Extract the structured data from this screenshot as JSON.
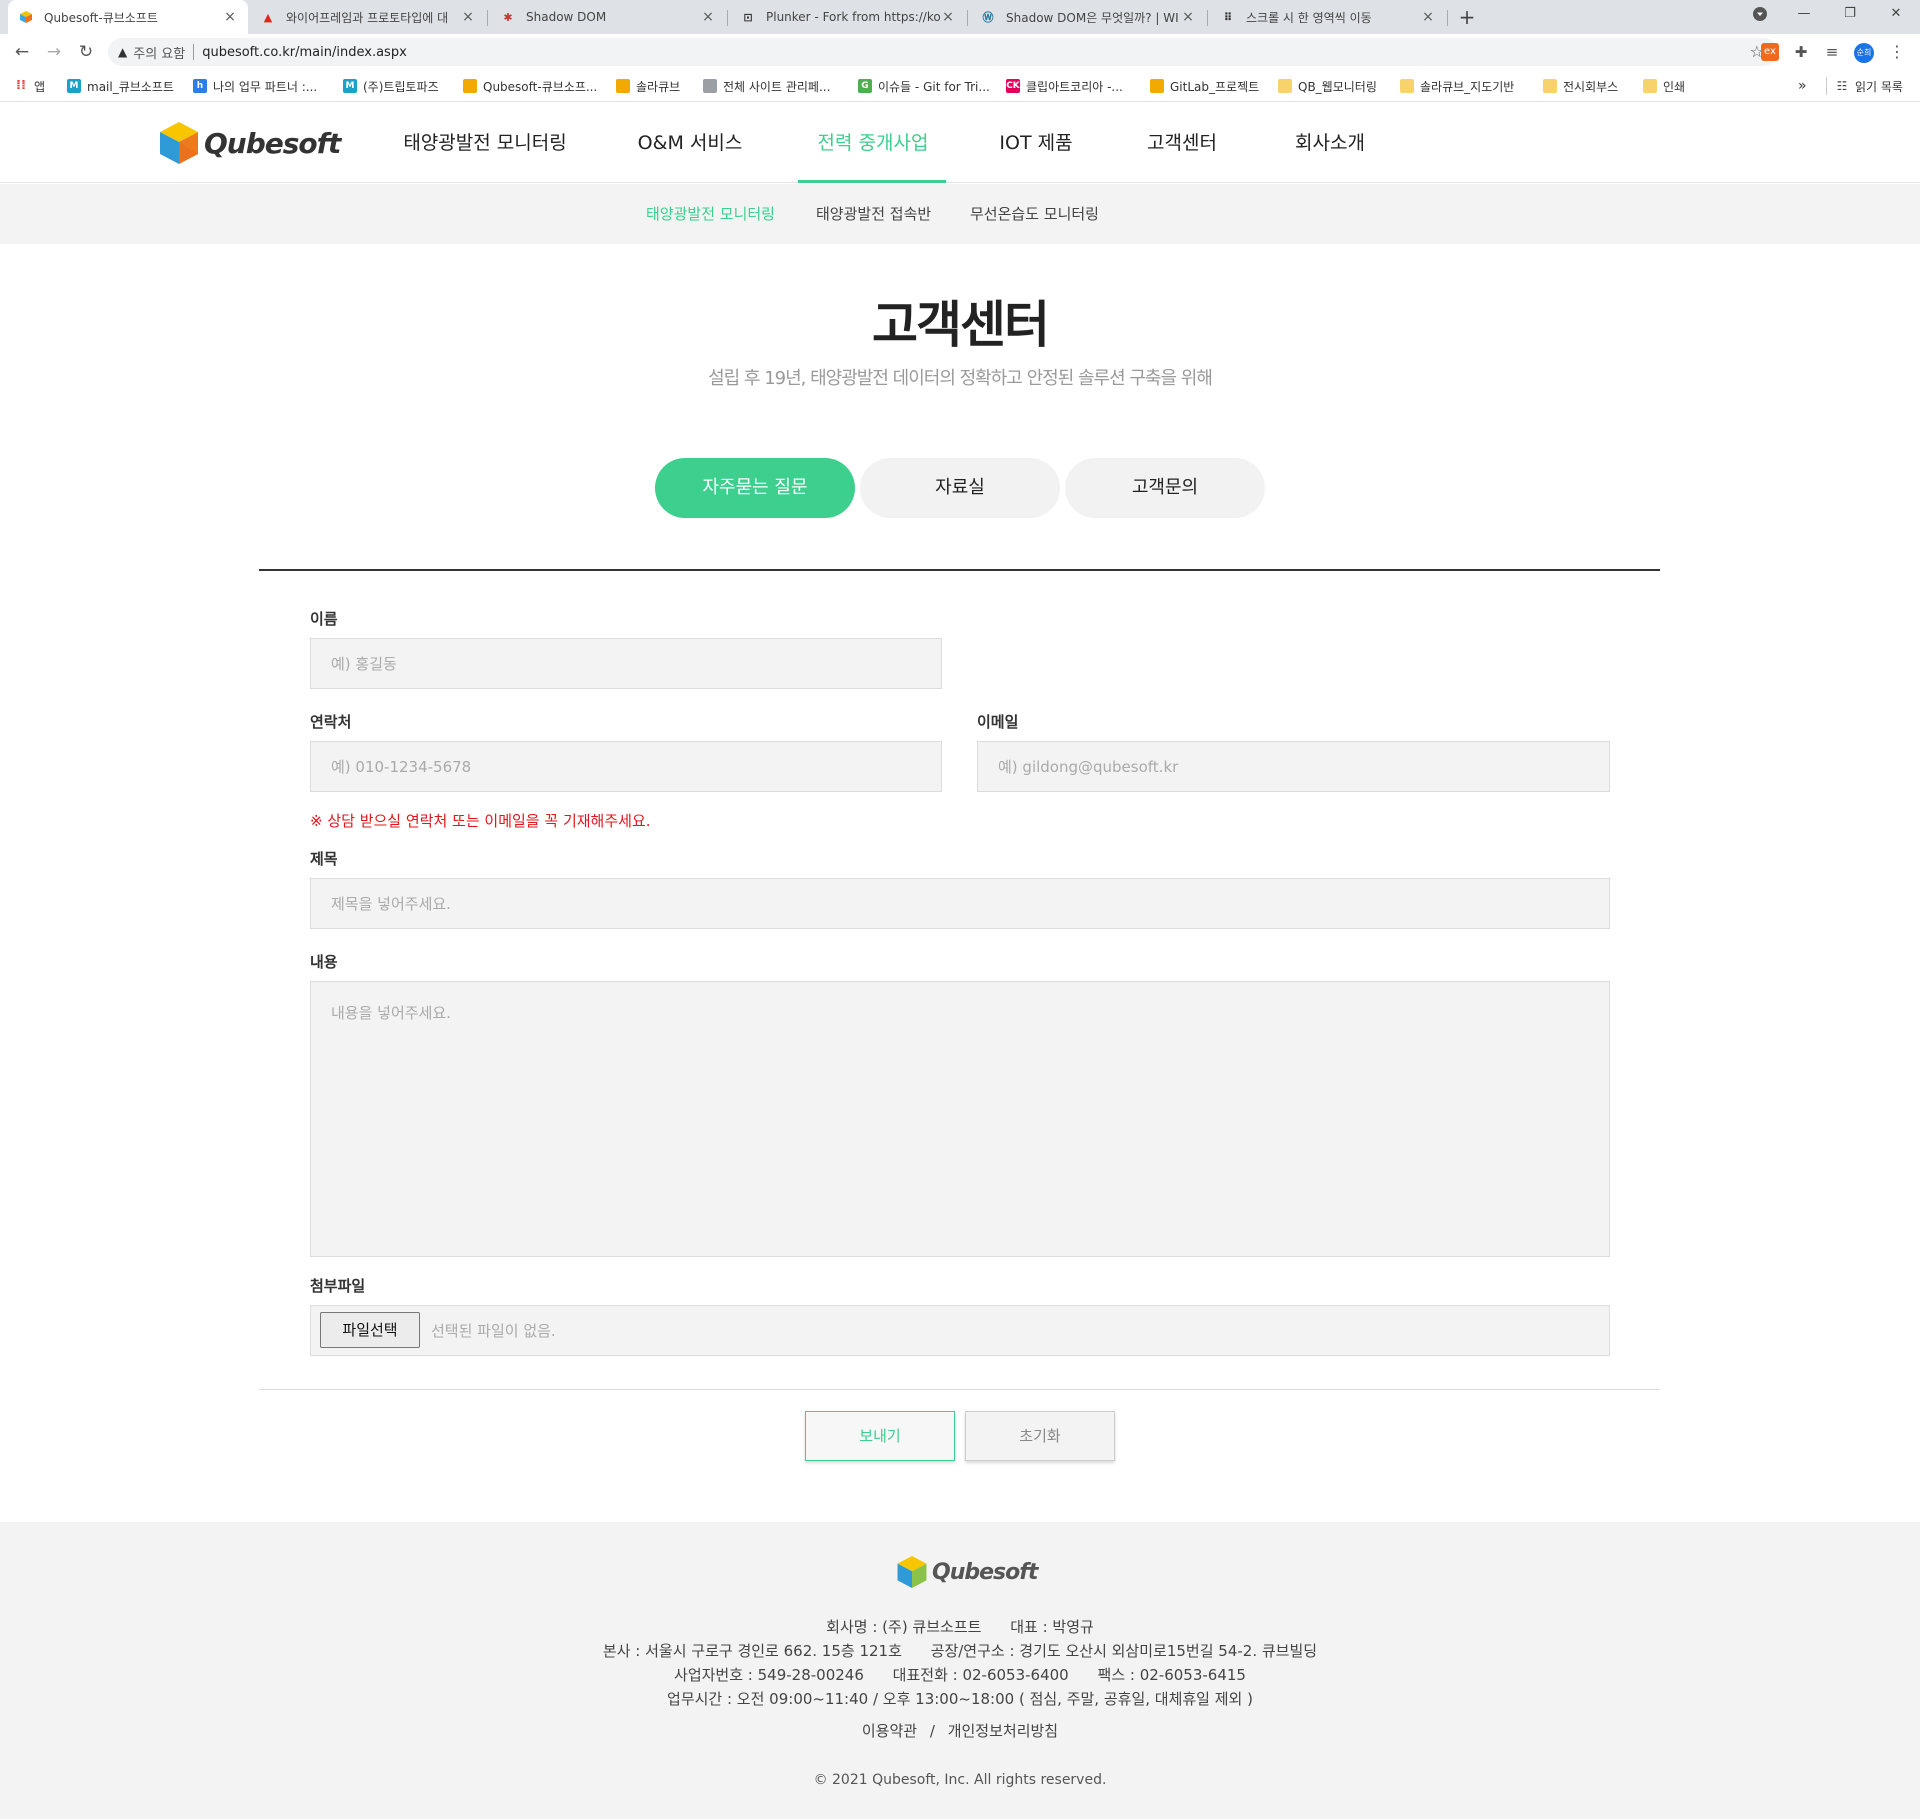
{
  "browser": {
    "tabs": [
      {
        "title": "Qubesoft-큐브소프트",
        "icon": "cube-favicon"
      },
      {
        "title": "와이어프레임과 프로토타입에 대",
        "icon": "adobe-favicon"
      },
      {
        "title": "Shadow DOM",
        "icon": "dom-favicon"
      },
      {
        "title": "Plunker - Fork from https://ko.ja",
        "icon": "plunker-favicon"
      },
      {
        "title": "Shadow DOM은 무엇일까? | WI",
        "icon": "wordpress-favicon"
      },
      {
        "title": "스크롤 시 한 영역씩 이동",
        "icon": "dots-favicon"
      }
    ],
    "security_label": "주의 요함",
    "url": "qubesoft.co.kr/main/index.aspx",
    "bookmarks": [
      {
        "label": "앱",
        "icon": "apps-grid-icon",
        "color": "#e94235"
      },
      {
        "label": "mail_큐브소프트",
        "icon": "m-icon",
        "color": "#1aa3c8"
      },
      {
        "label": "나의 업무 파트너 :...",
        "icon": "partner-icon",
        "color": "#2b7de9"
      },
      {
        "label": "(주)트립토파즈",
        "icon": "m-icon",
        "color": "#1aa3c8"
      },
      {
        "label": "Qubesoft-큐브소프...",
        "icon": "cube-icon",
        "color": "#f2a900"
      },
      {
        "label": "솔라큐브",
        "icon": "cube-icon",
        "color": "#f2a900"
      },
      {
        "label": "전체 사이트 관리페...",
        "icon": "page-icon",
        "color": "#9aa0a6"
      },
      {
        "label": "이슈들 - Git for Tri...",
        "icon": "git-icon",
        "color": "#4caf50"
      },
      {
        "label": "클립아트코리아 -...",
        "icon": "ck-icon",
        "color": "#e6005c"
      },
      {
        "label": "GitLab_프로젝트",
        "icon": "cube-icon",
        "color": "#f2a900"
      },
      {
        "label": "QB_웹모니터링",
        "icon": "folder-icon",
        "color": "#f7d36b"
      },
      {
        "label": "솔라큐브_지도기반",
        "icon": "folder-icon",
        "color": "#f7d36b"
      },
      {
        "label": "전시회부스",
        "icon": "folder-icon",
        "color": "#f7d36b"
      },
      {
        "label": "인쇄",
        "icon": "folder-icon",
        "color": "#f7d36b"
      }
    ],
    "more_label": "»",
    "reading_list_label": "읽기 목록",
    "profile_label": "순희"
  },
  "site": {
    "brand": "Qubesoft",
    "accent": "#3ccf8e",
    "gnb": [
      "태양광발전 모니터링",
      "O&M 서비스",
      "전력 중개사업",
      "IOT 제품",
      "고객센터",
      "회사소개"
    ],
    "gnb_active": "전력 중개사업",
    "subnav": [
      "태양광발전 모니터링",
      "태양광발전 접속반",
      "무선온습도 모니터링"
    ],
    "subnav_active": "태양광발전 모니터링"
  },
  "page": {
    "title": "고객센터",
    "subtitle": "설립 후 19년, 태양광발전 데이터의 정확하고 안정된 솔루션 구축을 위해",
    "tabs": [
      "자주묻는 질문",
      "자료실",
      "고객문의"
    ],
    "tab_active": "자주묻는 질문"
  },
  "form": {
    "name_label": "이름",
    "name_placeholder": "예) 홍길동",
    "phone_label": "연락처",
    "phone_placeholder": "예) 010-1234-5678",
    "email_label": "이메일",
    "email_placeholder": "예) gildong@qubesoft.kr",
    "notice": "※ 상담 받으실 연락처 또는 이메일을 꼭 기재해주세요.",
    "subject_label": "제목",
    "subject_placeholder": "제목을 넣어주세요.",
    "content_label": "내용",
    "content_placeholder": "내용을 넣어주세요.",
    "file_label": "첨부파일",
    "file_button": "파일선택",
    "file_status": "선택된 파일이 없음.",
    "send_label": "보내기",
    "reset_label": "초기화"
  },
  "footer": {
    "brand": "Qubesoft",
    "company_label": "회사명 : (주) 큐브소프트",
    "ceo_label": "대표 : 박영규",
    "hq_label": "본사 : 서울시 구로구 경인로 662. 15층 121호",
    "factory_label": "공장/연구소 : 경기도 오산시 외삼미로15번길 54-2. 큐브빌딩",
    "bizno_label": "사업자번호 : 549-28-00246",
    "tel_label": "대표전화 : 02-6053-6400",
    "fax_label": "팩스 : 02-6053-6415",
    "hours_label": "업무시간 : 오전 09:00~11:40 / 오후 13:00~18:00 ( 점심, 주말, 공휴일, 대체휴일 제외 )",
    "terms_label": "이용약관",
    "links_sep": "/",
    "privacy_label": "개인정보처리방침",
    "copyright": "© 2021 Qubesoft, Inc. All rights reserved."
  }
}
